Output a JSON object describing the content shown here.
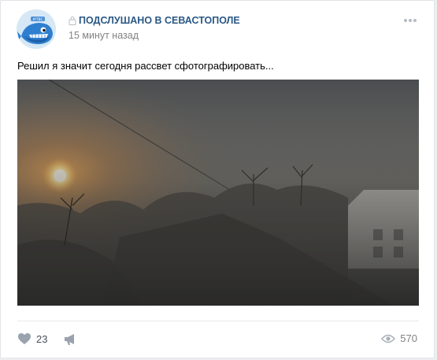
{
  "post": {
    "author": "ПОДСЛУШАНО В СЕВАСТОПОЛЕ",
    "date": "15 минут назад",
    "text": "Решил я значит сегодня рассвет сфотографировать...",
    "avatar_badge": "#ПВС",
    "likes": "23",
    "views": "570"
  },
  "icons": {
    "lock": "lock-icon",
    "menu": "more-horizontal-icon",
    "like": "heart-icon",
    "share": "megaphone-share-icon",
    "views": "eye-icon"
  },
  "colors": {
    "link": "#2a5885",
    "muted": "#828282",
    "background": "#edeef0",
    "icon": "#99a2ad"
  }
}
